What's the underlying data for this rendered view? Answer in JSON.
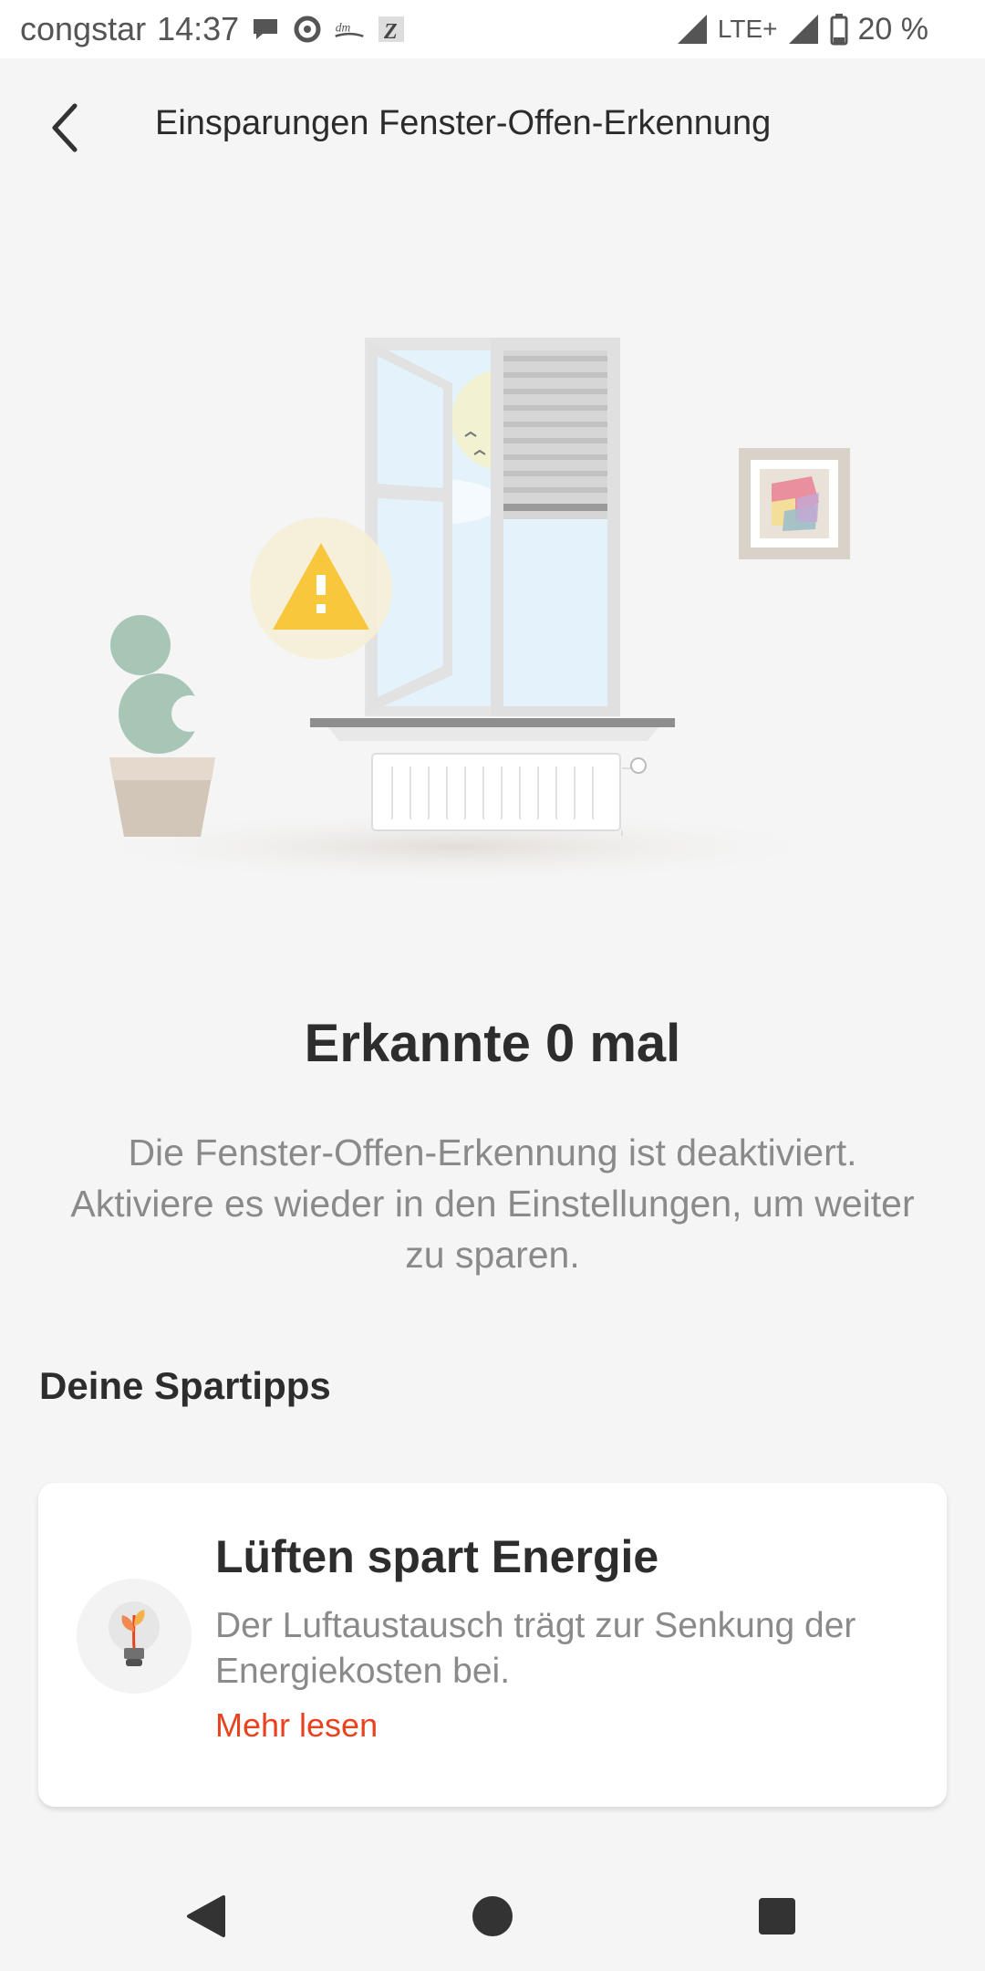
{
  "status_bar": {
    "carrier": "congstar",
    "time": "14:37",
    "network": "LTE+",
    "battery": "20 %",
    "notification_icons": [
      "chat-bubble-icon",
      "refresh-app-icon",
      "dm-app-icon",
      "z-app-icon"
    ]
  },
  "app_bar": {
    "title": "Einsparungen Fenster-Offen-Erkennung",
    "back_icon": "chevron-left-icon"
  },
  "main": {
    "headline": "Erkannte 0 mal",
    "description": "Die Fenster-Offen-Erkennung ist deaktiviert. Aktiviere es wieder in den Einstellungen, um weiter zu sparen.",
    "section_title": "Deine Spartipps"
  },
  "tips": [
    {
      "icon": "lightbulb-plant-icon",
      "title": "Lüften spart Energie",
      "text": "Der Luftaustausch trägt zur Senkung der Energiekosten bei.",
      "link": "Mehr lesen"
    }
  ],
  "colors": {
    "background": "#f5f5f5",
    "accent_link": "#e8431e",
    "warning": "#f8c73c"
  },
  "nav_bar": {
    "icons": [
      "nav-back-icon",
      "nav-home-icon",
      "nav-recents-icon"
    ]
  }
}
